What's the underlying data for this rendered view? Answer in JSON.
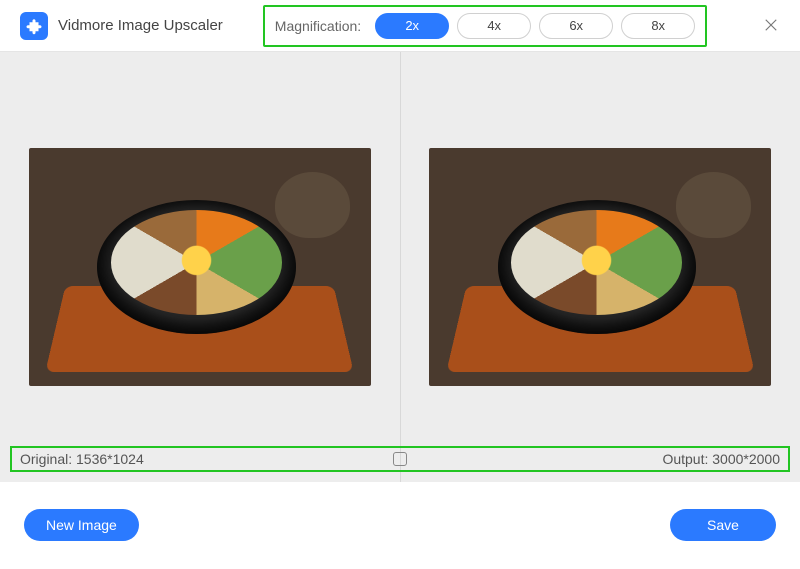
{
  "header": {
    "title": "Vidmore Image Upscaler",
    "magnification_label": "Magnification:",
    "options": [
      "2x",
      "4x",
      "6x",
      "8x"
    ],
    "selected_option": "2x"
  },
  "preview": {
    "original_label": "Original: 1536*1024",
    "output_label": "Output: 3000*2000"
  },
  "footer": {
    "new_image_label": "New Image",
    "save_label": "Save"
  },
  "colors": {
    "accent": "#2b7aff",
    "highlight_box": "#22c522"
  }
}
